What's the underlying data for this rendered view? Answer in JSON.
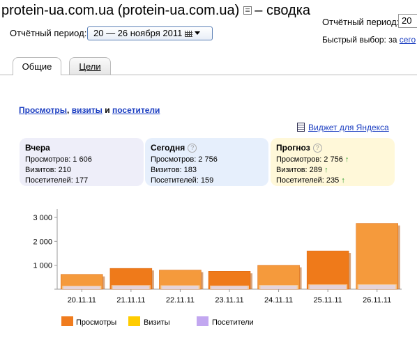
{
  "header": {
    "title": "protein-ua.com.ua (protein-ua.com.ua)",
    "title_suffix": "– сводка",
    "period_label": "Отчётный период:",
    "period_value": "20 — 26 ноября 2011",
    "right_period_label": "Отчётный период:",
    "right_period_value": "20",
    "quick_label": "Быстрый выбор: за",
    "quick_link": "сего"
  },
  "tabs": [
    {
      "label": "Общие",
      "active": true
    },
    {
      "label": "Цели",
      "active": false
    }
  ],
  "metrics_heading": {
    "views": "Просмотры",
    "sep1": ", ",
    "visits": "визиты",
    "and": " и ",
    "visitors": "посетители"
  },
  "widget_link": "Виджет для Яндекса",
  "cards": {
    "yesterday": {
      "title": "Вчера",
      "views": "Просмотров: 1 606",
      "visits": "Визитов: 210",
      "visitors": "Посетителей: 177"
    },
    "today": {
      "title": "Сегодня",
      "views": "Просмотров: 2 756",
      "visits": "Визитов: 183",
      "visitors": "Посетителей: 159"
    },
    "forecast": {
      "title": "Прогноз",
      "views": "Просмотров: 2 756",
      "visits": "Визитов: 289",
      "visitors": "Посетителей: 235",
      "arrow": "↑"
    }
  },
  "legend": [
    {
      "label": "Просмотры",
      "color": "#f07c1e"
    },
    {
      "label": "Визиты",
      "color": "#ffcc00"
    },
    {
      "label": "Посетители",
      "color": "#c2a7f0"
    }
  ],
  "chart_data": {
    "type": "bar",
    "categories": [
      "20.11.11",
      "21.11.11",
      "22.11.11",
      "23.11.11",
      "24.11.11",
      "25.11.11",
      "26.11.11"
    ],
    "series": [
      {
        "name": "Просмотры",
        "values": [
          620,
          870,
          800,
          750,
          1000,
          1600,
          2750
        ]
      },
      {
        "name": "Визиты",
        "values": [
          140,
          170,
          160,
          150,
          170,
          200,
          200
        ]
      },
      {
        "name": "Посетители",
        "values": [
          120,
          140,
          140,
          130,
          150,
          170,
          180
        ]
      }
    ],
    "ylim": [
      0,
      3000
    ],
    "yticks": [
      "1 000",
      "2 000",
      "3 000"
    ],
    "ytick_values": [
      1000,
      2000,
      3000
    ],
    "grid": false
  }
}
